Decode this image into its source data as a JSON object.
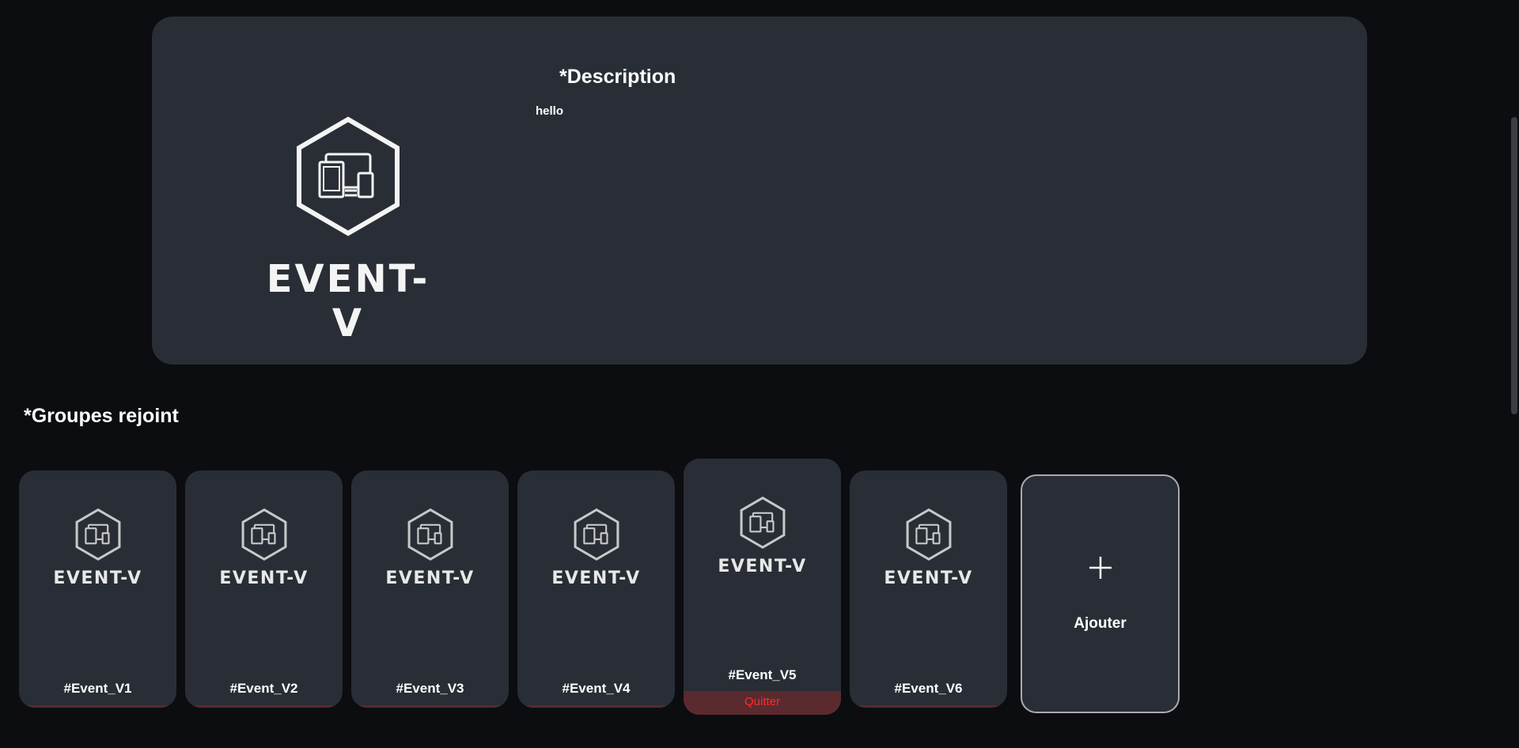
{
  "hero": {
    "logo_text": "EVENT-V",
    "description_title": "*Description",
    "description_text": "hello"
  },
  "groups": {
    "title": "*Groupes rejoint",
    "cards": [
      {
        "logo_text": "EVENT-V",
        "name": "#Event_V1"
      },
      {
        "logo_text": "EVENT-V",
        "name": "#Event_V2"
      },
      {
        "logo_text": "EVENT-V",
        "name": "#Event_V3"
      },
      {
        "logo_text": "EVENT-V",
        "name": "#Event_V4"
      },
      {
        "logo_text": "EVENT-V",
        "name": "#Event_V5",
        "action": "Quitter"
      },
      {
        "logo_text": "EVENT-V",
        "name": "#Event_V6"
      }
    ],
    "add_label": "Ajouter",
    "add_icon": "plus-icon"
  },
  "colors": {
    "background": "#0b0d10",
    "panel": "#292e36",
    "quit_text": "#ff2a2a",
    "quit_bar": "#5a2a2f"
  }
}
